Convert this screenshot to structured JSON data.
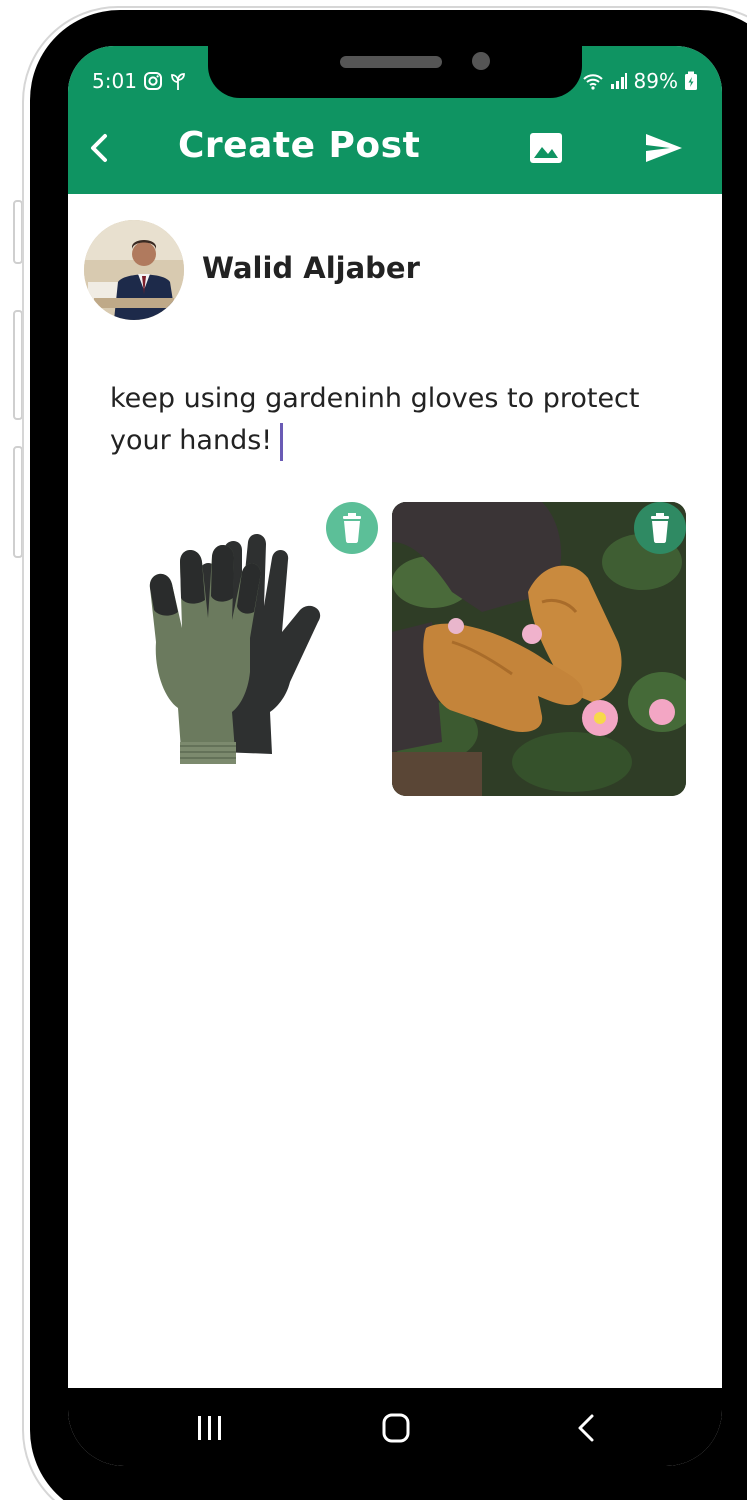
{
  "status_bar": {
    "time": "5:01",
    "battery": "89%"
  },
  "app_bar": {
    "title": "Create Post",
    "back_icon": "chevron-left-icon",
    "image_icon": "image-icon",
    "send_icon": "send-icon"
  },
  "author": {
    "name": "Walid Aljaber"
  },
  "post": {
    "text": "keep using gardeninh gloves to protect your hands!"
  },
  "attachments": [
    {
      "description_icon": "gloves-product-image",
      "delete_icon": "trash-icon"
    },
    {
      "description_icon": "gardening-hands-photo",
      "delete_icon": "trash-icon"
    }
  ],
  "colors": {
    "primary": "#0f9462",
    "delete_light": "#5cbf98",
    "delete_dark": "#2f8a63",
    "caret": "#6a5bb5"
  },
  "nav_bar": {
    "recent_icon": "recent-apps-icon",
    "home_icon": "home-icon",
    "back_icon": "back-icon"
  }
}
